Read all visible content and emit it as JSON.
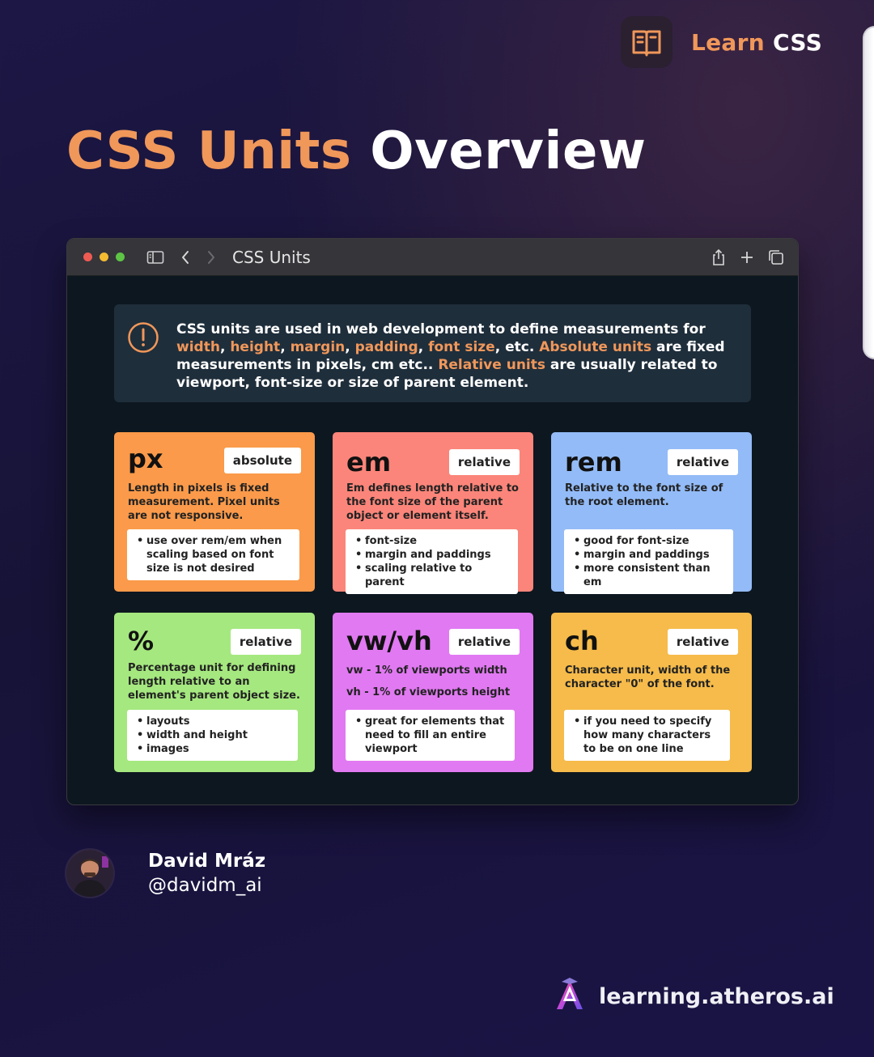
{
  "header": {
    "badge_accent": "Learn",
    "badge_rest": "CSS",
    "badge_icon": "open-book-icon"
  },
  "title": {
    "accent": "CSS Units",
    "rest": "Overview"
  },
  "window": {
    "tab_title": "CSS Units",
    "controls": [
      "close-dot",
      "minimize-dot",
      "zoom-dot",
      "sidebar-icon",
      "back-icon",
      "forward-icon",
      "share-icon",
      "plus-icon",
      "tabs-icon"
    ]
  },
  "notice": {
    "segments": [
      {
        "t": "CSS units are used in web development to define measurements for ",
        "hl": false
      },
      {
        "t": "width",
        "hl": true
      },
      {
        "t": ", ",
        "hl": false
      },
      {
        "t": "height",
        "hl": true
      },
      {
        "t": ", ",
        "hl": false
      },
      {
        "t": "margin",
        "hl": true
      },
      {
        "t": ", ",
        "hl": false
      },
      {
        "t": "padding",
        "hl": true
      },
      {
        "t": ", ",
        "hl": false
      },
      {
        "t": "font size",
        "hl": true
      },
      {
        "t": ", etc. ",
        "hl": false
      },
      {
        "t": "Absolute units",
        "hl": true
      },
      {
        "t": " are fixed measurements in pixels, cm etc.. ",
        "hl": false
      },
      {
        "t": "Relative units",
        "hl": true
      },
      {
        "t": " are usually related to viewport, font-size or size of parent element.",
        "hl": false
      }
    ]
  },
  "cards": [
    {
      "unit": "px",
      "tag": "absolute",
      "color": "#fa9a4a",
      "desc": "Length in pixels is fixed measurement. Pixel units are not responsive.",
      "items": [
        "use over rem/em when scaling based on font size is not desired"
      ]
    },
    {
      "unit": "em",
      "tag": "relative",
      "color": "#fb857a",
      "desc": "Em defines length relative to the font size of the parent object or element itself.",
      "items": [
        "font-size",
        "margin and paddings",
        "scaling relative to parent"
      ]
    },
    {
      "unit": "rem",
      "tag": "relative",
      "color": "#93bbf7",
      "desc": "Relative to the font size of the root element.",
      "items": [
        "good for font-size",
        "margin and paddings",
        "more consistent than em"
      ]
    },
    {
      "unit": "%",
      "tag": "relative",
      "color": "#a5e87f",
      "desc": "Percentage unit for defining length relative to an element's parent object size.",
      "items": [
        "layouts",
        "width and height",
        "images"
      ]
    },
    {
      "unit": "vw/vh",
      "tag": "relative",
      "color": "#e179f2",
      "desc": "vw - 1% of viewports width",
      "desc2": "vh - 1% of viewports height",
      "items": [
        "great for elements that need to fill an entire viewport"
      ]
    },
    {
      "unit": "ch",
      "tag": "relative",
      "color": "#f6bb4a",
      "desc": "Character unit,  width of the character \"0\" of the font.",
      "items": [
        "if you need to specify how many characters to be on one line"
      ]
    }
  ],
  "author": {
    "name": "David Mráz",
    "handle": "@davidm_ai"
  },
  "brand": {
    "text": "learning.atheros.ai",
    "icon": "atheros-logo-icon"
  },
  "colors": {
    "accent": "#f0975a",
    "bg": "#1c1745",
    "window_bg": "#0d1720",
    "notice_bg": "#1f2e3b"
  }
}
